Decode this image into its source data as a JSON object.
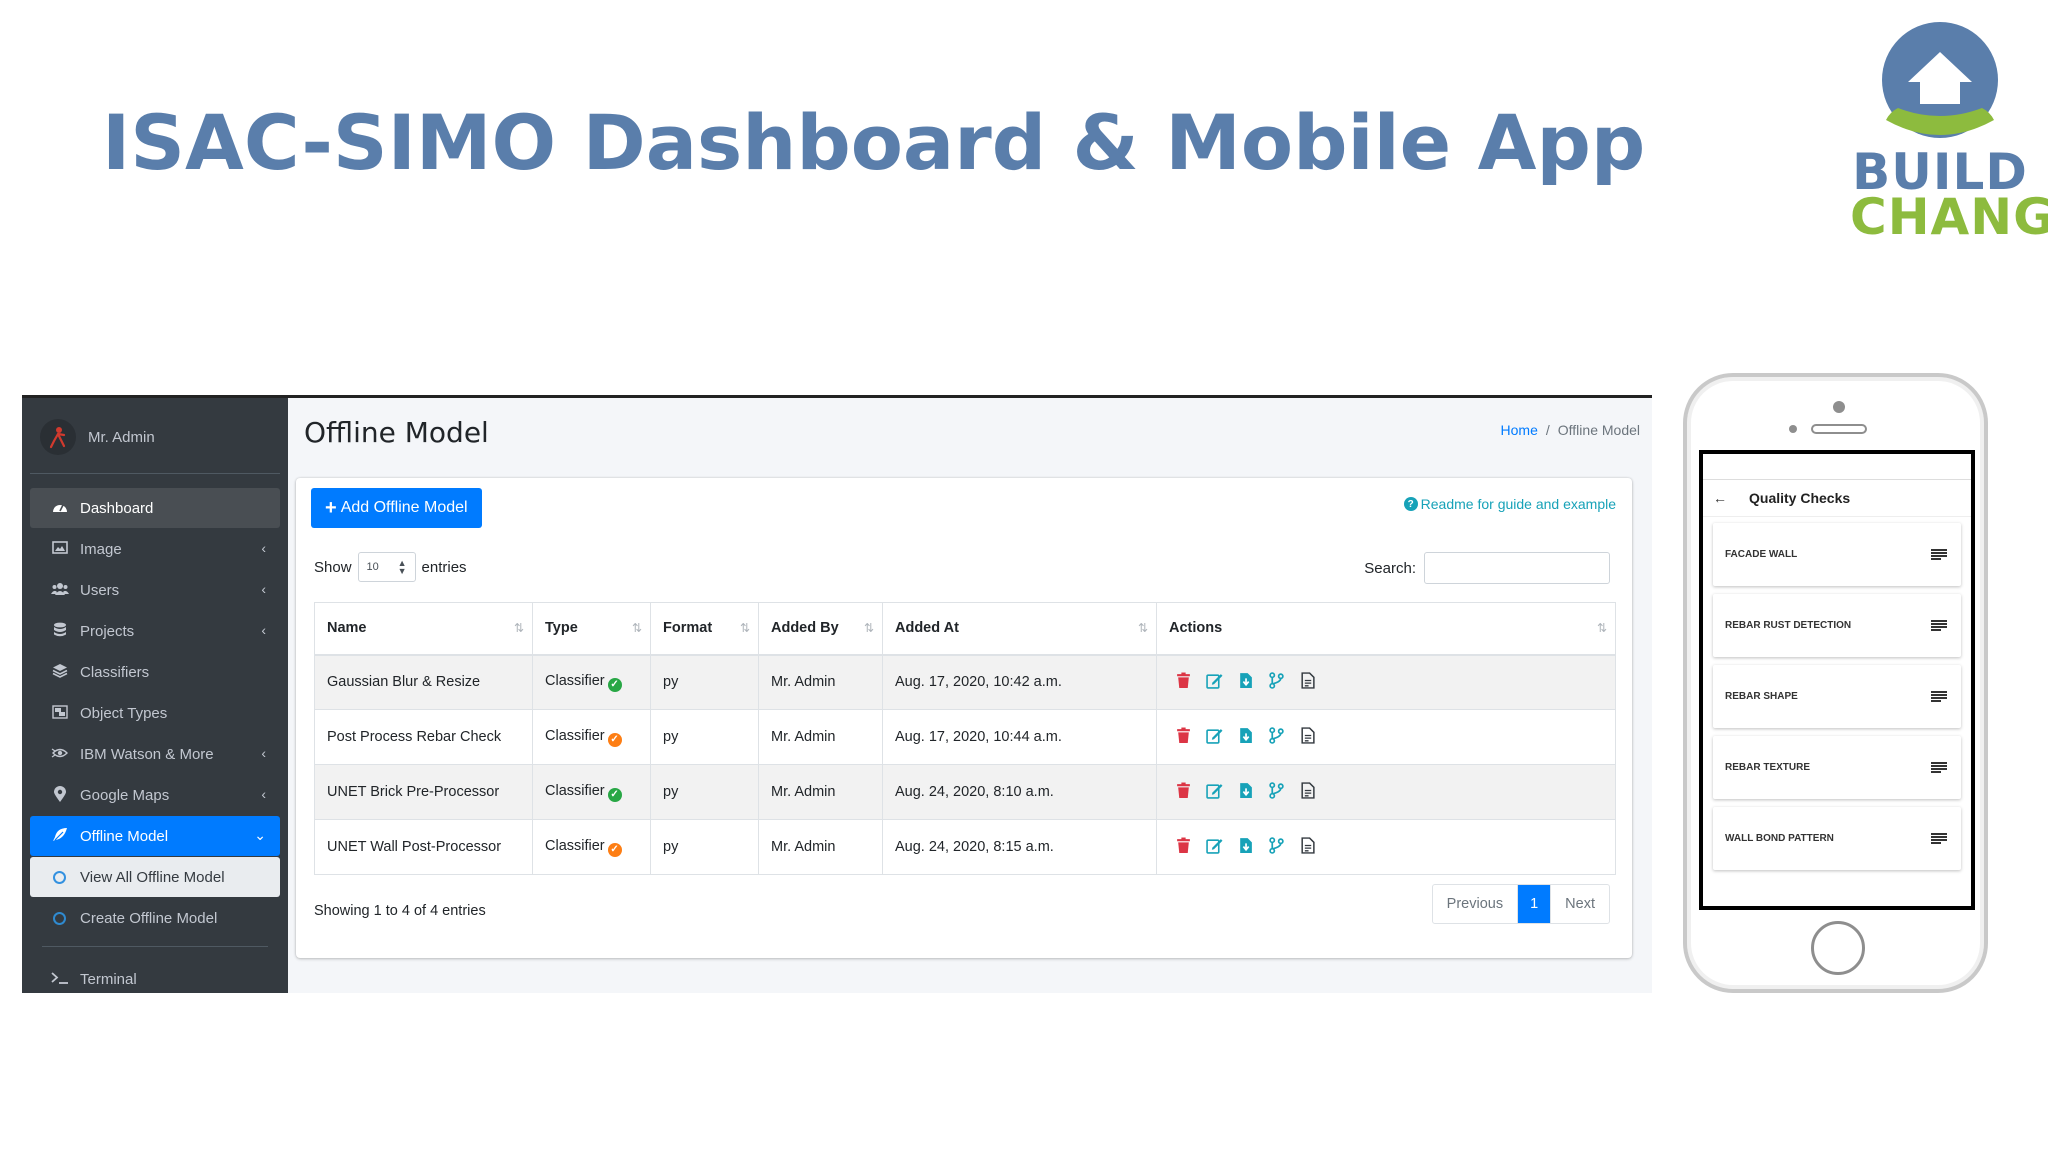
{
  "slide": {
    "title": "ISAC-SIMO Dashboard & Mobile App",
    "title_color": "#5a7eab"
  },
  "logo": {
    "line1": "BUILD",
    "line2": "CHANGE",
    "colors": {
      "blue": "#5a7eab",
      "green": "#8dbb3e"
    }
  },
  "sidebar": {
    "user_name": "Mr. Admin",
    "items": [
      {
        "label": "Dashboard",
        "icon": "tachometer-icon"
      },
      {
        "label": "Image",
        "icon": "image-icon"
      },
      {
        "label": "Users",
        "icon": "users-icon"
      },
      {
        "label": "Projects",
        "icon": "database-icon"
      },
      {
        "label": "Classifiers",
        "icon": "layers-icon"
      },
      {
        "label": "Object Types",
        "icon": "object-group-icon"
      },
      {
        "label": "IBM Watson & More",
        "icon": "watson-icon"
      },
      {
        "label": "Google Maps",
        "icon": "map-marker-icon"
      },
      {
        "label": "Offline Model",
        "icon": "feather-icon"
      },
      {
        "label": "View All Offline Model",
        "icon": "circle-icon"
      },
      {
        "label": "Create Offline Model",
        "icon": "circle-icon"
      },
      {
        "label": "Terminal",
        "icon": "terminal-icon"
      }
    ]
  },
  "header": {
    "page_title": "Offline Model",
    "breadcrumb_home": "Home",
    "breadcrumb_separator": "/",
    "breadcrumb_current": "Offline Model"
  },
  "card": {
    "add_button": "Add Offline Model",
    "readme_link": "Readme for guide and example",
    "show_label": "Show",
    "show_value": "10",
    "entries_label": "entries",
    "search_label": "Search:"
  },
  "table": {
    "columns": [
      "Name",
      "Type",
      "Format",
      "Added By",
      "Added At",
      "Actions"
    ],
    "rows": [
      {
        "name": "Gaussian Blur & Resize",
        "type": "Classifier",
        "status": "active",
        "format": "py",
        "added_by": "Mr. Admin",
        "added_at": "Aug. 17, 2020, 10:42 a.m."
      },
      {
        "name": "Post Process Rebar Check",
        "type": "Classifier",
        "status": "pending",
        "format": "py",
        "added_by": "Mr. Admin",
        "added_at": "Aug. 17, 2020, 10:44 a.m."
      },
      {
        "name": "UNET Brick Pre-Processor",
        "type": "Classifier",
        "status": "active",
        "format": "py",
        "added_by": "Mr. Admin",
        "added_at": "Aug. 24, 2020, 8:10 a.m."
      },
      {
        "name": "UNET Wall Post-Processor",
        "type": "Classifier",
        "status": "pending",
        "format": "py",
        "added_by": "Mr. Admin",
        "added_at": "Aug. 24, 2020, 8:15 a.m."
      }
    ]
  },
  "footer": {
    "showing": "Showing 1 to 4 of 4 entries",
    "previous": "Previous",
    "page": "1",
    "next": "Next"
  },
  "phone": {
    "screen_title": "Quality Checks",
    "items": [
      "FACADE WALL",
      "REBAR RUST DETECTION",
      "REBAR SHAPE",
      "REBAR TEXTURE",
      "WALL BOND PATTERN"
    ]
  },
  "colors": {
    "primary": "#007bff",
    "sidebar_bg": "#343a40",
    "status_active": "#28a745",
    "status_pending": "#fd7e14",
    "delete": "#dc3545",
    "info": "#17a2b8"
  }
}
